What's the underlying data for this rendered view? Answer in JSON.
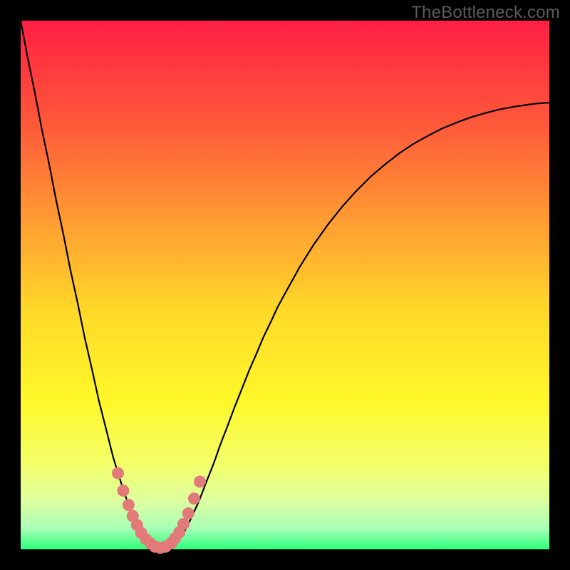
{
  "watermark": "TheBottleneck.com",
  "gradient": {
    "angle_deg": 180,
    "stops": [
      {
        "offset": 0.0,
        "color": "#ff1f44"
      },
      {
        "offset": 0.2,
        "color": "#ff5a3a"
      },
      {
        "offset": 0.4,
        "color": "#ffa431"
      },
      {
        "offset": 0.55,
        "color": "#ffd928"
      },
      {
        "offset": 0.72,
        "color": "#fff82a"
      },
      {
        "offset": 0.84,
        "color": "#f3ff6a"
      },
      {
        "offset": 0.91,
        "color": "#dcffa0"
      },
      {
        "offset": 0.96,
        "color": "#a9ffb6"
      },
      {
        "offset": 1.0,
        "color": "#2dff7c"
      }
    ]
  },
  "curve": {
    "stroke": "#000000",
    "stroke_width": 2.2
  },
  "marker": {
    "fill": "#e27a7a",
    "radius": 8.5
  },
  "chart_data": {
    "type": "line",
    "title": "",
    "xlabel": "",
    "ylabel": "",
    "xlim": [
      0,
      100
    ],
    "ylim": [
      0,
      100
    ],
    "y_axis_inverted_note": "y=0 is green (bottom), y=100 is red (top)",
    "series": [
      {
        "name": "bottleneck-curve",
        "x": [
          0.0,
          1.3,
          2.7,
          4.0,
          5.4,
          6.7,
          8.1,
          9.4,
          10.8,
          12.1,
          13.5,
          14.8,
          16.2,
          17.5,
          18.9,
          20.2,
          21.6,
          22.9,
          24.3,
          25.0,
          26.0,
          27.0,
          28.0,
          29.7,
          31.1,
          32.4,
          33.8,
          35.1,
          36.5,
          37.8,
          39.2,
          40.5,
          41.9,
          43.2,
          44.6,
          45.9,
          47.3,
          48.6,
          50.0,
          51.4,
          52.7,
          55.4,
          58.1,
          60.8,
          63.5,
          66.2,
          68.9,
          71.6,
          74.3,
          77.0,
          79.7,
          82.4,
          85.1,
          87.8,
          90.5,
          93.2,
          95.9,
          97.3,
          98.6,
          100.0
        ],
        "y": [
          100.0,
          93.1,
          86.3,
          79.5,
          72.8,
          66.1,
          59.5,
          52.9,
          46.5,
          40.1,
          34.0,
          28.1,
          22.6,
          17.4,
          12.9,
          9.0,
          5.8,
          3.4,
          1.6,
          1.1,
          0.5,
          0.2,
          0.4,
          1.6,
          3.6,
          6.2,
          9.3,
          12.7,
          16.2,
          19.9,
          23.5,
          27.0,
          30.5,
          33.8,
          37.0,
          40.1,
          43.0,
          45.8,
          48.4,
          50.9,
          53.3,
          57.6,
          61.4,
          64.8,
          67.8,
          70.5,
          72.8,
          74.9,
          76.7,
          78.2,
          79.6,
          80.7,
          81.7,
          82.5,
          83.2,
          83.7,
          84.1,
          84.3,
          84.4,
          84.5
        ]
      }
    ],
    "markers": {
      "name": "highlighted-points",
      "x": [
        18.4,
        19.4,
        20.4,
        21.2,
        22.0,
        22.8,
        23.7,
        24.6,
        25.4,
        26.4,
        27.4,
        28.5,
        29.2,
        30.0,
        30.8,
        31.7,
        32.8,
        33.9
      ],
      "y": [
        14.4,
        11.1,
        8.4,
        6.3,
        4.6,
        3.1,
        1.9,
        1.1,
        0.5,
        0.3,
        0.5,
        1.2,
        2.1,
        3.2,
        4.8,
        6.8,
        9.6,
        12.8
      ]
    }
  }
}
